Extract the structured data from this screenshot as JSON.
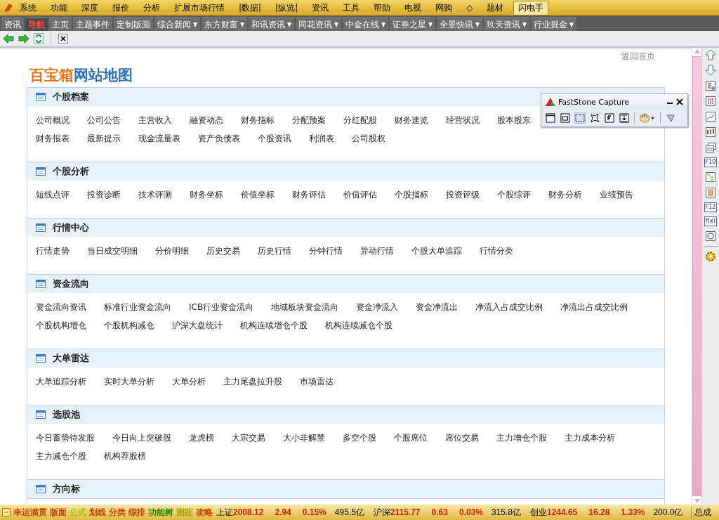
{
  "menu_bar": {
    "items": [
      "系统",
      "功能",
      "深度",
      "报价",
      "分析",
      "扩展市场行情",
      "|数据|",
      "|纵览|",
      "资讯",
      "工具",
      "帮助",
      "电视",
      "网购",
      "◇",
      "题材"
    ],
    "button": "闪电手"
  },
  "nav_tabs": [
    {
      "label": "资讯",
      "kind": "plain",
      "selected": false
    },
    {
      "label": "导航",
      "kind": "plain",
      "selected": true
    },
    {
      "label": "主页",
      "kind": "plain",
      "selected": false
    },
    {
      "label": "主题事件",
      "kind": "plain",
      "selected": false
    },
    {
      "label": "定制版面",
      "kind": "plain",
      "selected": false
    },
    {
      "label": "综合新闻",
      "kind": "dropdown",
      "selected": false
    },
    {
      "label": "东方财富",
      "kind": "dropdown",
      "selected": false
    },
    {
      "label": "和讯资讯",
      "kind": "dropdown",
      "selected": false
    },
    {
      "label": "同花资讯",
      "kind": "dropdown",
      "selected": false
    },
    {
      "label": "中金在线",
      "kind": "dropdown",
      "selected": false
    },
    {
      "label": "证券之星",
      "kind": "dropdown",
      "selected": false
    },
    {
      "label": "全景快讯",
      "kind": "dropdown",
      "selected": false
    },
    {
      "label": "玖天资讯",
      "kind": "dropdown",
      "selected": false
    },
    {
      "label": "行业掘金",
      "kind": "dropdown",
      "selected": false
    }
  ],
  "page": {
    "back_link": "返回首页",
    "title_part_1": "百宝箱",
    "title_part_2": "网站地图",
    "sections": [
      {
        "title": "个股档案",
        "link_rows": [
          [
            "公司概况",
            "公司公告",
            "主营收入",
            "融资动态",
            "财务指标",
            "分配预案",
            "分红配股",
            "财务速览",
            "经营状况",
            "股本股东"
          ],
          [
            "财务报表",
            "最新提示",
            "现金流量表",
            "资产负债表",
            "个股资讯",
            "利润表",
            "公司股权"
          ]
        ]
      },
      {
        "title": "个股分析",
        "link_rows": [
          [
            "短线点评",
            "投资诊断",
            "技术评测",
            "财务坐标",
            "价值坐标",
            "财务评估",
            "价值评估",
            "个股指标",
            "投资评级",
            "个股综评",
            "财务分析",
            "业绩预告"
          ]
        ]
      },
      {
        "title": "行情中心",
        "link_rows": [
          [
            "行情走势",
            "当日成交明细",
            "分价明细",
            "历史交易",
            "历史行情",
            "分钟行情",
            "异动行情",
            "个股大单追踪",
            "行情分类"
          ]
        ]
      },
      {
        "title": "资金流向",
        "link_rows": [
          [
            "资金流向资讯",
            "标准行业资金流向",
            "ICB行业资金流向",
            "地域板块资金流向",
            "资金净流入",
            "资金净流出",
            "净流入占成交比例",
            "净流出占成交比例"
          ],
          [
            "个股机构增仓",
            "个股机构减仓",
            "沪深大盘统计",
            "机构连续增仓个股",
            "机构连续减仓个股"
          ]
        ]
      },
      {
        "title": "大单雷达",
        "link_rows": [
          [
            "大单追踪分析",
            "实时大单分析",
            "大单分析",
            "主力尾盘拉升股",
            "市场雷达"
          ]
        ]
      },
      {
        "title": "选股池",
        "link_rows": [
          [
            "今日蓄势待发股",
            "今日向上突破股",
            "龙虎榜",
            "大宗交易",
            "大小非解禁",
            "多空个股",
            "个股席位",
            "席位交易",
            "主力增仓个股",
            "主力成本分析"
          ],
          [
            "主力减仓个股",
            "机构荐股榜"
          ]
        ]
      },
      {
        "title": "方向标"
      }
    ]
  },
  "capture_window": {
    "title": "FastStone Capture"
  },
  "right_toolbar": [
    {
      "kind": "up"
    },
    {
      "kind": "down"
    },
    {
      "kind": "sheet"
    },
    {
      "kind": "grid"
    },
    {
      "kind": "line"
    },
    {
      "kind": "candle"
    },
    {
      "kind": "list"
    },
    {
      "kind": "key",
      "label": "F10"
    },
    {
      "kind": "tree"
    },
    {
      "kind": "book"
    },
    {
      "kind": "key",
      "label": "F12"
    },
    {
      "kind": "key",
      "label": "f(x)"
    },
    {
      "kind": "circle"
    },
    {
      "kind": "gear"
    }
  ],
  "status_bar": {
    "shortcuts": [
      {
        "label": "幸运满贯",
        "color": "#c83c00"
      },
      {
        "label": "版面",
        "color": "#c83c00"
      },
      {
        "label": "公式",
        "color": "#a8c800"
      },
      {
        "label": "划线",
        "color": "#c83c00"
      },
      {
        "label": "分类",
        "color": "#c83c00"
      },
      {
        "label": "综排",
        "color": "#c83c00"
      },
      {
        "label": "功能树",
        "color": "#2a8a00"
      },
      {
        "label": "测距",
        "color": "#a8a000"
      },
      {
        "label": "攻略",
        "color": "#c83c00"
      }
    ],
    "quotes": [
      {
        "label": "上证",
        "value": "2008.12",
        "change": "2.94",
        "percent": "0.15%",
        "amount": "495.5亿",
        "up": true
      },
      {
        "label": "沪深",
        "value": "2115.77",
        "change": "0.63",
        "percent": "0.03%",
        "amount": "315.8亿",
        "up": true
      },
      {
        "label": "创业",
        "value": "1244.65",
        "change": "16.28",
        "percent": "1.33%",
        "amount": "200.0亿",
        "up": true
      }
    ],
    "total_label": "总成"
  }
}
